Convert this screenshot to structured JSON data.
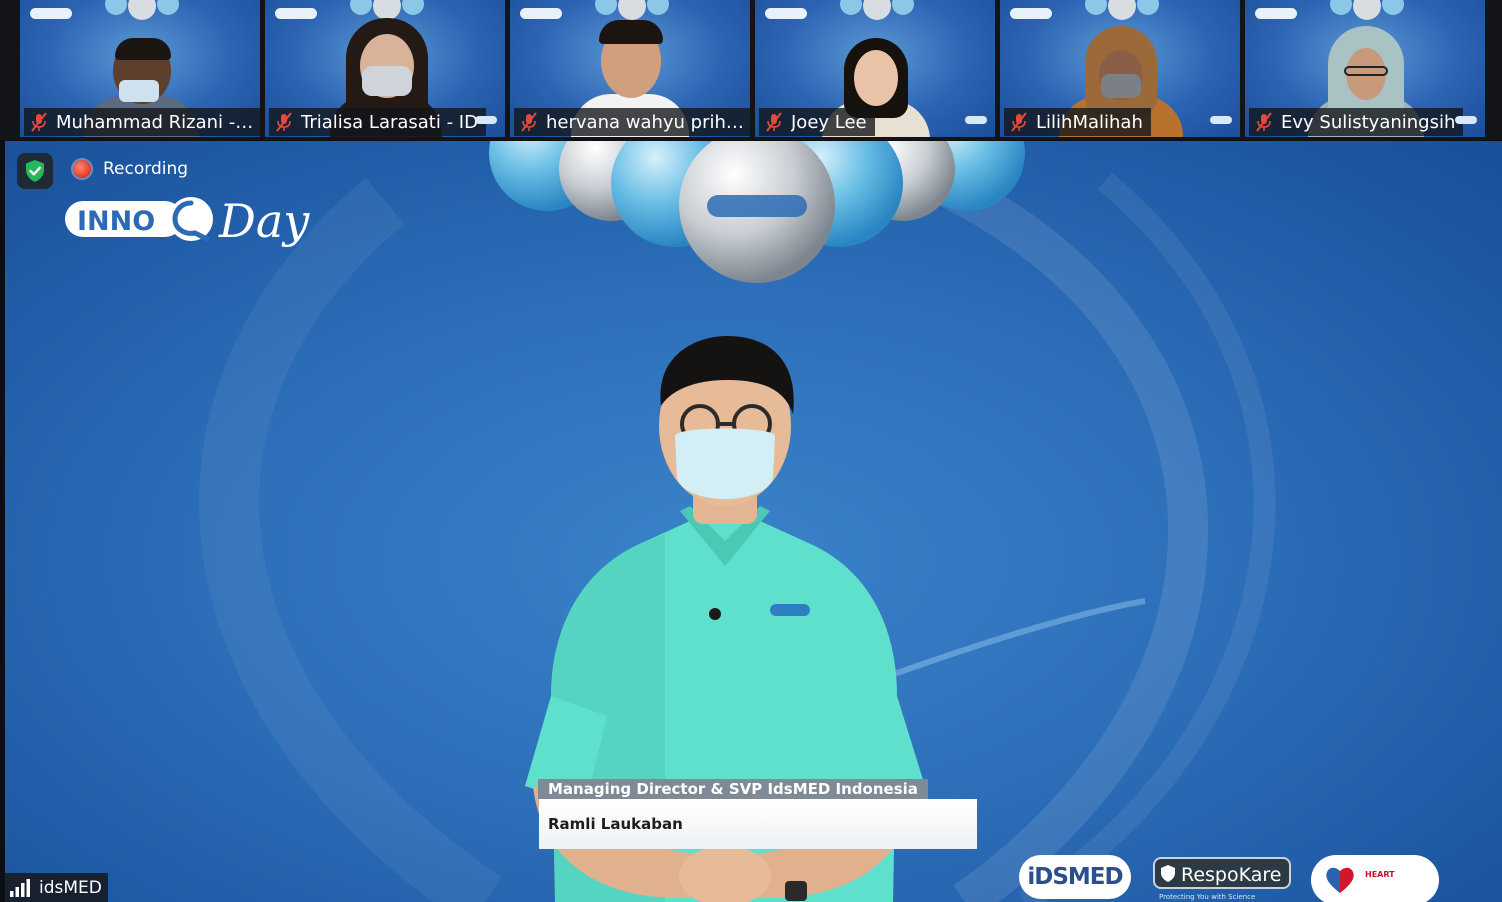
{
  "gallery": {
    "participants": [
      {
        "name": "Muhammad Rizani - S...",
        "muted": true,
        "mic_icon": "mic-muted-icon"
      },
      {
        "name": "Trialisa Larasati - ID",
        "muted": true,
        "mic_icon": "mic-muted-icon"
      },
      {
        "name": "hervana wahyu prihat...",
        "muted": true,
        "mic_icon": "mic-muted-icon"
      },
      {
        "name": "Joey Lee",
        "muted": true,
        "mic_icon": "mic-muted-icon"
      },
      {
        "name": "LilihMalihah",
        "muted": true,
        "mic_icon": "mic-muted-icon"
      },
      {
        "name": "Evy Sulistyaningsih",
        "muted": true,
        "mic_icon": "mic-muted-icon"
      }
    ]
  },
  "stage": {
    "security_icon": "shield-check-icon",
    "recording_label": "Recording",
    "event_logo_text": "INNOQ Day",
    "lower_third": {
      "title": "Managing Director & SVP IdsMED Indonesia",
      "name": "Ramli Laukaban"
    },
    "sponsor_logos": {
      "idsmed": "iDSMED",
      "respokare": "RespoKare",
      "respokare_tagline": "Protecting You with Science",
      "heart_tagline": "HEART"
    }
  },
  "active_speaker": {
    "name": "idsMED",
    "signal_icon": "signal-bars-icon"
  },
  "colors": {
    "stage_blue": "#2d6fb9",
    "muted_red": "#e5483c",
    "security_green": "#25b85a",
    "nameplate_bg": "#121418"
  }
}
